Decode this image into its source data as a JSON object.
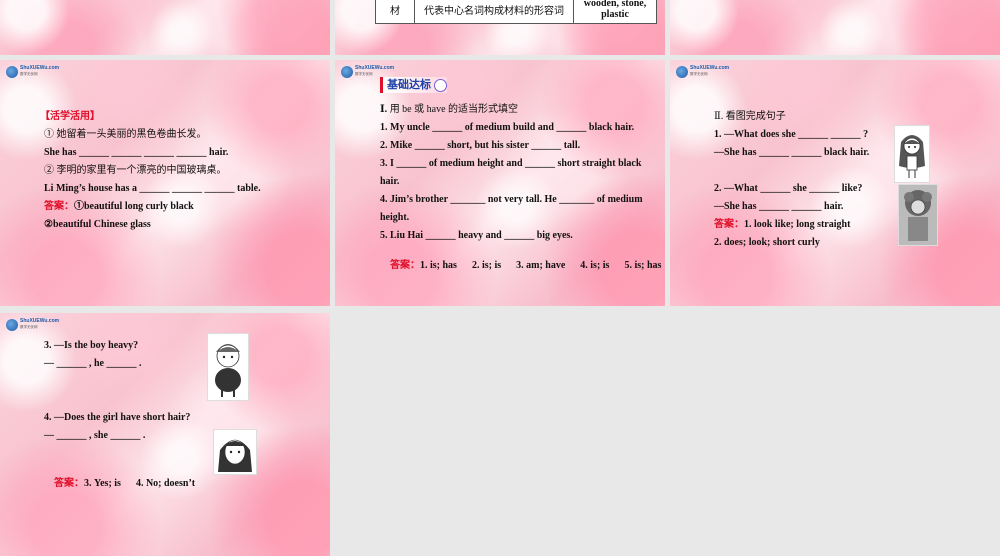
{
  "slide_top": {
    "col1": "材",
    "col2": "代表中心名词构成材料的形容词",
    "col3_line1": "wooden, stone,",
    "col3_line2": "plastic"
  },
  "logo": {
    "text": "ShuXUEWu.com",
    "sub": "数学无忧网"
  },
  "slide_a": {
    "heading": "【活学活用】",
    "q1_cn": "① 她留着一头美丽的黑色卷曲长发。",
    "q1_en": "She has ______ ______ ______ ______ hair.",
    "q2_cn": "② 李明的家里有一个漂亮的中国玻璃桌。",
    "q2_en": "Li Ming’s house has a ______ ______ ______ table.",
    "ans_label": "答案",
    "ans1": "①beautiful long curly black",
    "ans2": "②beautiful Chinese glass"
  },
  "slide_b": {
    "badge": "基础达标",
    "instr_num": "Ⅰ.",
    "instr": "用 be 或 have 的适当形式填空",
    "q1": "1. My uncle ______ of medium build and ______ black hair.",
    "q2": "2. Mike ______ short, but his sister ______ tall.",
    "q3a": "3. I ______ of medium height and ______ short straight black",
    "q3b": "hair.",
    "q4a": "4. Jim’s brother _______ not very tall. He _______ of medium",
    "q4b": "height.",
    "q5": "5. Liu Hai ______ heavy and ______ big eyes.",
    "ans_label": "答案",
    "ans": "1. is; has      2. is; is      3. am; have      4. is; is      5. is; has"
  },
  "slide_c": {
    "instr": "Ⅱ. 看图完成句子",
    "q1a": "1. —What does she ______ ______ ?",
    "q1b": "—She has ______ ______ black hair.",
    "q2a": "2. —What ______ she ______ like?",
    "q2b": "—She has ______ ______ hair.",
    "ans_label": "答案",
    "ans1": "1. look like; long straight",
    "ans2": "2. does; look; short curly"
  },
  "slide_d": {
    "q3a": "3. —Is the boy heavy?",
    "q3b": "— ______ , he ______ .",
    "q4a": "4. —Does the girl have short hair?",
    "q4b": "— ______ , she ______ .",
    "ans_label": "答案",
    "ans": "3. Yes; is      4. No; doesn’t"
  }
}
